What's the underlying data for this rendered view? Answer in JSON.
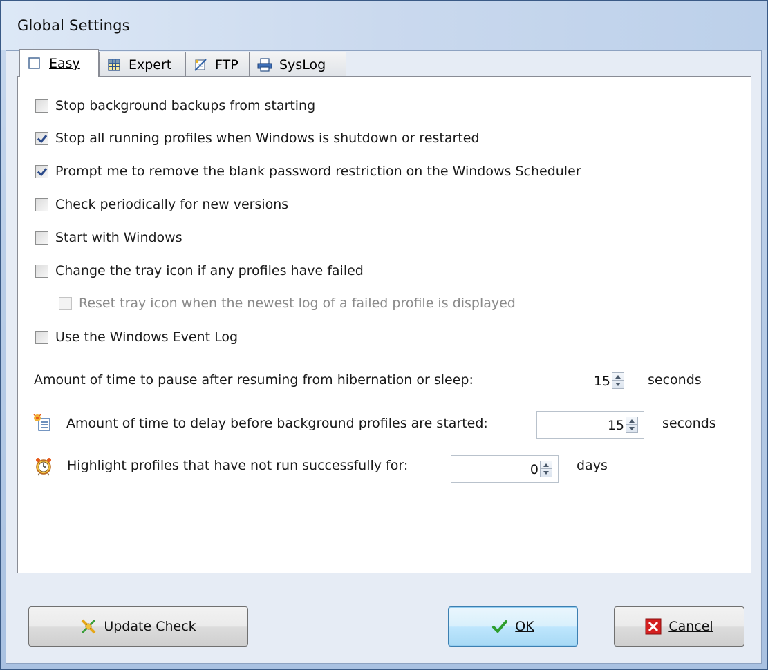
{
  "window": {
    "title": "Global Settings"
  },
  "tabs": [
    {
      "label": "Easy",
      "icon": "blank-page-icon",
      "active": true
    },
    {
      "label": "Expert",
      "icon": "grid-icon",
      "active": false
    },
    {
      "label": "FTP",
      "icon": "ftp-icon",
      "active": false
    },
    {
      "label": "SysLog",
      "icon": "printer-icon",
      "active": false
    }
  ],
  "options": [
    {
      "label": "Stop background backups from starting",
      "checked": false,
      "enabled": true
    },
    {
      "label": "Stop all running profiles when Windows is shutdown or restarted",
      "checked": true,
      "enabled": true
    },
    {
      "label": "Prompt me to remove the blank password restriction on the Windows Scheduler",
      "checked": true,
      "enabled": true
    },
    {
      "label": "Check periodically for new versions",
      "checked": false,
      "enabled": true
    },
    {
      "label": "Start with Windows",
      "checked": false,
      "enabled": true
    },
    {
      "label": "Change the tray icon if any profiles have failed",
      "checked": false,
      "enabled": true
    },
    {
      "label": "Reset tray icon when the newest log of a failed profile is displayed",
      "checked": false,
      "enabled": false
    },
    {
      "label": "Use the Windows Event Log",
      "checked": false,
      "enabled": true
    }
  ],
  "pause": {
    "label": "Amount of time to pause after resuming from hibernation or sleep:",
    "value": "15",
    "unit": "seconds"
  },
  "delay": {
    "label": "Amount of time to delay before background profiles are started:",
    "value": "15",
    "unit": "seconds",
    "icon": "schedule-icon"
  },
  "highlight": {
    "label": "Highlight profiles that have not run successfully for:",
    "value": "0",
    "unit": "days",
    "icon": "alarm-clock-icon"
  },
  "buttons": {
    "update": "Update Check",
    "ok": "OK",
    "cancel": "Cancel"
  },
  "colors": {
    "accent": "#3c7fb1",
    "ok_check": "#2e9e2e",
    "cancel_red": "#d42020"
  }
}
